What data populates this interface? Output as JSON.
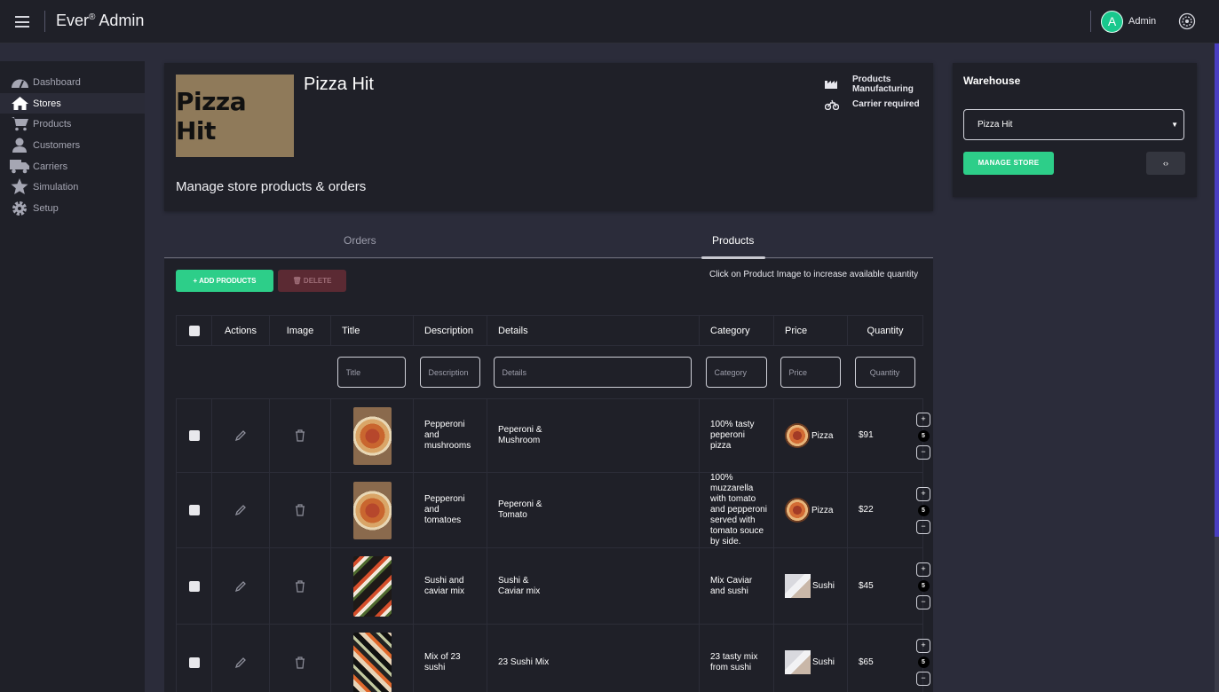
{
  "header": {
    "brand": "Ever",
    "brand_mark": "®",
    "brand_suffix": " Admin",
    "avatar_letter": "A",
    "user": "Admin"
  },
  "sidebar": {
    "items": [
      {
        "label": "Dashboard",
        "icon": "dashboard-icon",
        "active": false
      },
      {
        "label": "Stores",
        "icon": "home-icon",
        "active": true
      },
      {
        "label": "Products",
        "icon": "cart-icon",
        "active": false
      },
      {
        "label": "Customers",
        "icon": "user-icon",
        "active": false
      },
      {
        "label": "Carriers",
        "icon": "truck-icon",
        "active": false
      },
      {
        "label": "Simulation",
        "icon": "star-icon",
        "active": false
      },
      {
        "label": "Setup",
        "icon": "gear-icon",
        "active": false
      }
    ]
  },
  "store": {
    "logo_text": "Pizza Hit",
    "name": "Pizza Hit",
    "subtitle": "Manage store products & orders",
    "features": [
      {
        "icon": "factory-icon",
        "label_line1": "Products",
        "label_line2": "Manufacturing"
      },
      {
        "icon": "motorcycle-icon",
        "label_line1": "Carrier required",
        "label_line2": ""
      }
    ]
  },
  "warehouse": {
    "title": "Warehouse",
    "selected": "Pizza Hit",
    "manage_label": "MANAGE STORE",
    "code_label": "‹›"
  },
  "tabs": [
    {
      "label": "Orders",
      "active": false
    },
    {
      "label": "Products",
      "active": true
    }
  ],
  "toolbar": {
    "add_label": "+  ADD PRODUCTS",
    "delete_label": "🗑 DELETE",
    "hint": "Click on Product Image to increase available quantity"
  },
  "table": {
    "columns": [
      "",
      "Actions",
      "Image",
      "Title",
      "Description",
      "Details",
      "Category",
      "Price",
      "Quantity"
    ],
    "filters": {
      "title": "Title",
      "description": "Description",
      "details": "Details",
      "category": "Category",
      "price": "Price",
      "quantity": "Quantity"
    },
    "rows": [
      {
        "title_l1": "Pepperoni and",
        "title_l2": "mushrooms",
        "desc_l1": "Peperoni &",
        "desc_l2": "Mushroom",
        "details_l1": "100% tasty peperoni pizza",
        "details_l2": "",
        "category": "Pizza",
        "price": "$91",
        "quantity": "5",
        "image": "pizza"
      },
      {
        "title_l1": "Pepperoni and",
        "title_l2": "tomatoes",
        "desc_l1": "Peperoni &",
        "desc_l2": "Tomato",
        "details_l1": "100% muzzarella with tomato and pepperoni",
        "details_l2": "served with tomato souce by side.",
        "category": "Pizza",
        "price": "$22",
        "quantity": "5",
        "image": "pizza"
      },
      {
        "title_l1": "Sushi and",
        "title_l2": "caviar mix",
        "desc_l1": "Sushi &",
        "desc_l2": "Caviar mix",
        "details_l1": "Mix Caviar and sushi",
        "details_l2": "",
        "category": "Sushi",
        "price": "$45",
        "quantity": "5",
        "image": "sushi"
      },
      {
        "title_l1": "Mix of 23",
        "title_l2": "sushi",
        "desc_l1": "23 Sushi Mix",
        "desc_l2": "",
        "details_l1": "23 tasty mix from sushi",
        "details_l2": "",
        "category": "Sushi",
        "price": "$65",
        "quantity": "5",
        "image": "sushi2"
      }
    ],
    "plus": "+",
    "minus": "−"
  }
}
